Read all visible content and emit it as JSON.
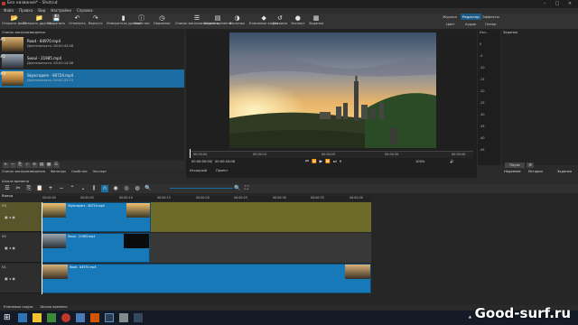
{
  "window": {
    "title": "Без названия* - Shotcut"
  },
  "menu": [
    "Файл",
    "Правка",
    "Вид",
    "Настройки",
    "Справка"
  ],
  "toolbar": [
    {
      "label": "Открыть файл",
      "icon": "folder-open-icon",
      "glyph": "📂"
    },
    {
      "label": "Открыть другой...",
      "icon": "folder-icon",
      "glyph": "📁"
    },
    {
      "label": "Сохранить",
      "icon": "save-icon",
      "glyph": "💾"
    },
    {
      "label": "Отменить",
      "icon": "undo-icon",
      "glyph": "↶"
    },
    {
      "label": "Вернуть",
      "icon": "redo-icon",
      "glyph": "↷"
    },
    {
      "label": "Измеритель уровня",
      "icon": "level-meter-icon",
      "glyph": "▮"
    },
    {
      "label": "Свойства",
      "icon": "properties-icon",
      "glyph": "ⓘ"
    },
    {
      "label": "Недавние",
      "icon": "recent-icon",
      "glyph": "◷"
    },
    {
      "label": "Список воспроизведения",
      "icon": "playlist-icon",
      "glyph": "☰"
    },
    {
      "label": "Шкала времени",
      "icon": "timeline-icon",
      "glyph": "▤"
    },
    {
      "label": "Фильтры",
      "icon": "filters-icon",
      "glyph": "◑"
    },
    {
      "label": "Ключевые кадры",
      "icon": "keyframes-icon",
      "glyph": "◆"
    },
    {
      "label": "История",
      "icon": "history-icon",
      "glyph": "↺"
    },
    {
      "label": "Экспорт",
      "icon": "export-icon",
      "glyph": "●"
    },
    {
      "label": "Задания",
      "icon": "jobs-icon",
      "glyph": "▦"
    }
  ],
  "layouts": {
    "row1": [
      "Журнал",
      "Редактор",
      "Эффекты"
    ],
    "row2": [
      "Цвет",
      "Аудио",
      "Плеер"
    ],
    "active": "Редактор"
  },
  "playlist": {
    "title": "Список воспроизведения",
    "items": [
      {
        "num": "#1",
        "name": "Road - 84970.mp4",
        "duration": "Длительность: 00:00:43:08"
      },
      {
        "num": "#2",
        "name": "Seoul - 21985.mp4",
        "duration": "Длительность: 00:00:14:08"
      },
      {
        "num": "#3",
        "name": "Skyscrapers - 80724.mp4",
        "duration": "Длительность: 00:00:25:15"
      }
    ],
    "tabs": [
      "Список воспроизведения",
      "Фильтры",
      "Свойства",
      "Экспорт"
    ]
  },
  "viewer": {
    "timecode_current": "00:00:00:00",
    "timecode_total": "00:00:43:08",
    "ruler": [
      "00:00:00",
      "00:00:10",
      "00:00:20",
      "00:00:30",
      "00:00:40"
    ],
    "tabs": [
      "Исходный",
      "Проект"
    ],
    "zoom": "100%",
    "controls": [
      "⏮",
      "⏪",
      "▶",
      "⏩",
      "⏭",
      "⏸"
    ]
  },
  "meter": {
    "header": "Изм...",
    "labels": [
      "0",
      "-5",
      "-10",
      "-15",
      "-20",
      "-25",
      "-30",
      "-35",
      "-40",
      "-45"
    ]
  },
  "history": {
    "title": "Задания",
    "pause_label": "Пауза",
    "tabs": [
      "Недавние",
      "История",
      "Задания"
    ]
  },
  "timeline": {
    "title": "Шкала времени",
    "output": "Вывод",
    "ruler": [
      "00:00:00",
      "00:00:05",
      "00:00:10",
      "00:00:15",
      "00:00:20",
      "00:00:25",
      "00:00:30",
      "00:00:35",
      "00:00:40"
    ],
    "tracks": [
      {
        "name": "V3",
        "clip": "Skyscrapers - 80724.mp4"
      },
      {
        "name": "V2",
        "clip": "Seoul - 21985.mp4"
      },
      {
        "name": "V1",
        "clip": "Road - 84970.mp4"
      }
    ],
    "bottom_tabs": [
      "Ключевые кадры",
      "Шкала времени"
    ]
  },
  "watermark": "Good-surf.ru",
  "colors": {
    "selection": "#1b6ea3",
    "clip": "#1879b8",
    "track_olive": "#6e6a28"
  }
}
